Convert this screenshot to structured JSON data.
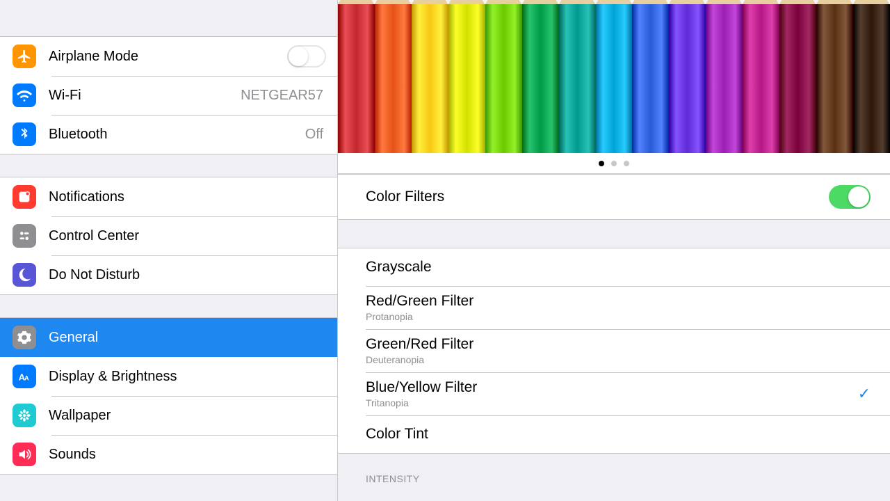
{
  "sidebar": {
    "group1": [
      {
        "label": "Airplane Mode",
        "value": "",
        "toggle": "off"
      },
      {
        "label": "Wi-Fi",
        "value": "NETGEAR57"
      },
      {
        "label": "Bluetooth",
        "value": "Off"
      }
    ],
    "group2": [
      {
        "label": "Notifications"
      },
      {
        "label": "Control Center"
      },
      {
        "label": "Do Not Disturb"
      }
    ],
    "group3": [
      {
        "label": "General",
        "selected": true
      },
      {
        "label": "Display & Brightness"
      },
      {
        "label": "Wallpaper"
      },
      {
        "label": "Sounds"
      }
    ]
  },
  "detail": {
    "pencil_colors": [
      "#c1272d",
      "#e65217",
      "#f7c815",
      "#d4e000",
      "#6cc900",
      "#009b46",
      "#009a8e",
      "#00a3d6",
      "#2a5bd7",
      "#5e2bd7",
      "#9b1fb2",
      "#b51884",
      "#7a003c",
      "#5a3013",
      "#2d1608"
    ],
    "page_dots": {
      "count": 3,
      "active": 0
    },
    "toggle_row": {
      "label": "Color Filters",
      "state": "on"
    },
    "filters": [
      {
        "title": "Grayscale",
        "sub": ""
      },
      {
        "title": "Red/Green Filter",
        "sub": "Protanopia"
      },
      {
        "title": "Green/Red Filter",
        "sub": "Deuteranopia"
      },
      {
        "title": "Blue/Yellow Filter",
        "sub": "Tritanopia",
        "checked": true
      },
      {
        "title": "Color Tint",
        "sub": ""
      }
    ],
    "intensity_label": "INTENSITY"
  }
}
